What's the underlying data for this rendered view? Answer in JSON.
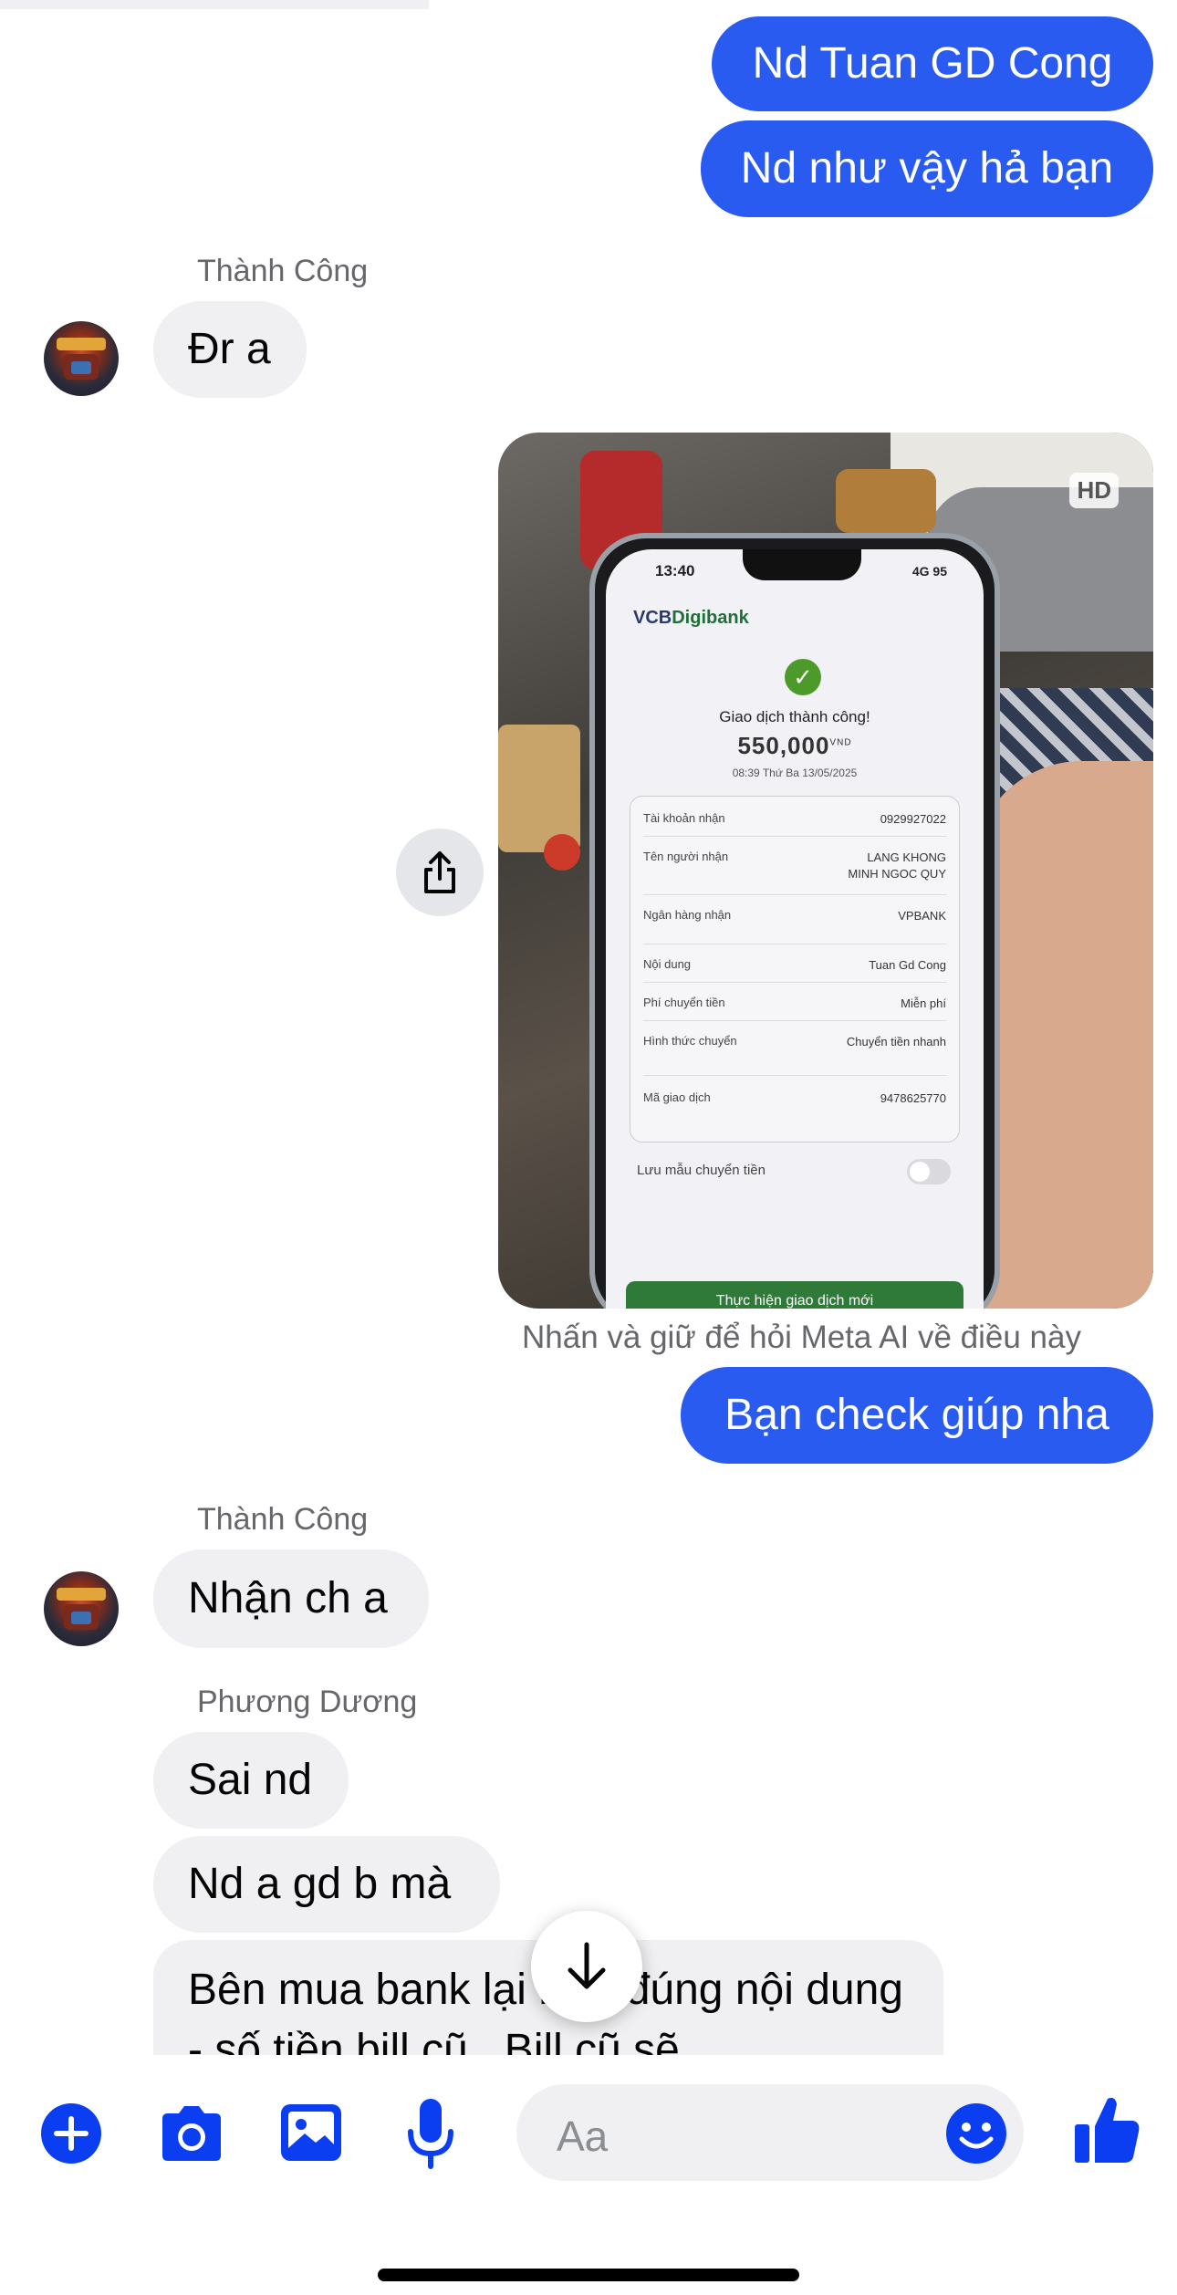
{
  "messages": {
    "out1": "Nd Tuan GD Cong",
    "out2": "Nd như vậy hả bạn",
    "sender1": "Thành Công",
    "in1": "Đr a",
    "photo": {
      "hd_label": "HD",
      "phone_time": "13:40",
      "phone_status": "4G 95",
      "bank_logo_a": "VCB",
      "bank_logo_b": "Digibank",
      "tx_title": "Giao dịch thành công!",
      "tx_amount": "550,000",
      "tx_currency": "VND",
      "tx_date": "08:39 Thứ Ba 13/05/2025",
      "rows": [
        {
          "k": "Tài khoản nhận",
          "v": "0929927022"
        },
        {
          "k": "Tên người nhận",
          "v": "LANG KHONG MINH NGOC QUY"
        },
        {
          "k": "Ngân hàng nhận",
          "v": "VPBANK"
        },
        {
          "k": "Nội dung",
          "v": "Tuan Gd Cong"
        },
        {
          "k": "Phí chuyển tiền",
          "v": "Miễn phí"
        },
        {
          "k": "Hình thức chuyển",
          "v": "Chuyển tiền nhanh"
        },
        {
          "k": "Mã giao dịch",
          "v": "9478625770"
        }
      ],
      "save_label": "Lưu mẫu chuyển tiền",
      "new_tx_button": "Thực hiện giao dịch mới"
    },
    "meta_ai_note": "Nhấn và giữ để hỏi Meta AI về điều này",
    "out3": "Bạn check giúp nha",
    "sender2": "Thành Công",
    "in2": "Nhận ch a",
    "sender3": "Phương Dương",
    "in3": "Sai nd",
    "in4": "Nd a gd b mà",
    "in5": "Bên mua bank lại mới đúng nội dung - số tiền bill cũ . Bill cũ sẽ"
  },
  "composer": {
    "placeholder": "Aa",
    "icons": [
      "plus-icon",
      "camera-icon",
      "image-icon",
      "microphone-icon",
      "emoji-icon",
      "thumbs-up-icon"
    ]
  },
  "colors": {
    "outgoing_bubble": "#2a5bf0",
    "incoming_bubble": "#f0f0f2",
    "accent": "#0a3ef0"
  }
}
